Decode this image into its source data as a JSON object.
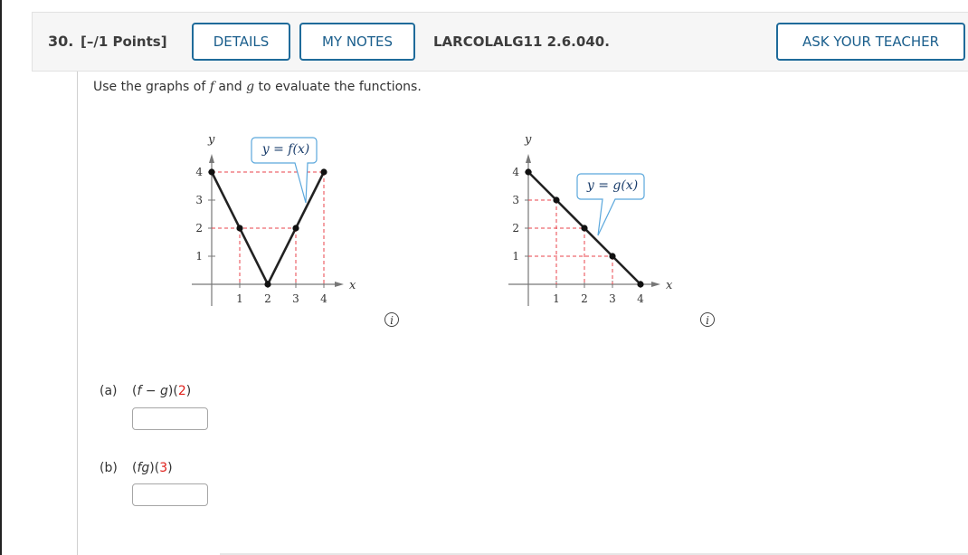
{
  "question": {
    "number": "30.",
    "points": "[–/1 Points]",
    "buttons": {
      "details": "DETAILS",
      "my_notes": "MY NOTES",
      "ask_teacher": "ASK YOUR TEACHER"
    },
    "problem_id": "LARCOLALG11 2.6.040.",
    "instructions": {
      "pre": "Use the graphs of ",
      "f": "f",
      "mid": " and ",
      "g": "g",
      "post": " to evaluate the functions."
    }
  },
  "graphs": {
    "f": {
      "label": "y = f(x)",
      "x_axis_label": "x",
      "y_axis_label": "y",
      "x_ticks": [
        "1",
        "2",
        "3",
        "4"
      ],
      "y_ticks": [
        "1",
        "2",
        "3",
        "4"
      ],
      "points": [
        [
          0,
          4
        ],
        [
          1,
          2
        ],
        [
          2,
          0
        ],
        [
          3,
          2
        ],
        [
          4,
          4
        ]
      ],
      "info_icon": "i"
    },
    "g": {
      "label": "y = g(x)",
      "x_axis_label": "x",
      "y_axis_label": "y",
      "x_ticks": [
        "1",
        "2",
        "3",
        "4"
      ],
      "y_ticks": [
        "1",
        "2",
        "3",
        "4"
      ],
      "points": [
        [
          0,
          4
        ],
        [
          1,
          3
        ],
        [
          2,
          2
        ],
        [
          3,
          1
        ],
        [
          4,
          0
        ]
      ],
      "info_icon": "i"
    }
  },
  "parts": [
    {
      "label": "(a)",
      "expr_open": "(",
      "expr_fn": "f − g",
      "expr_mid": ")(",
      "expr_arg": "2",
      "expr_close": ")",
      "answer": ""
    },
    {
      "label": "(b)",
      "expr_open": "(",
      "expr_fn": "fg",
      "expr_mid": ")(",
      "expr_arg": "3",
      "expr_close": ")",
      "answer": ""
    }
  ],
  "colors": {
    "accent": "#1f6b9a",
    "argument_red": "#e0201b",
    "dashed_guide": "#e8434b",
    "callout_border": "#5aa7dc"
  }
}
